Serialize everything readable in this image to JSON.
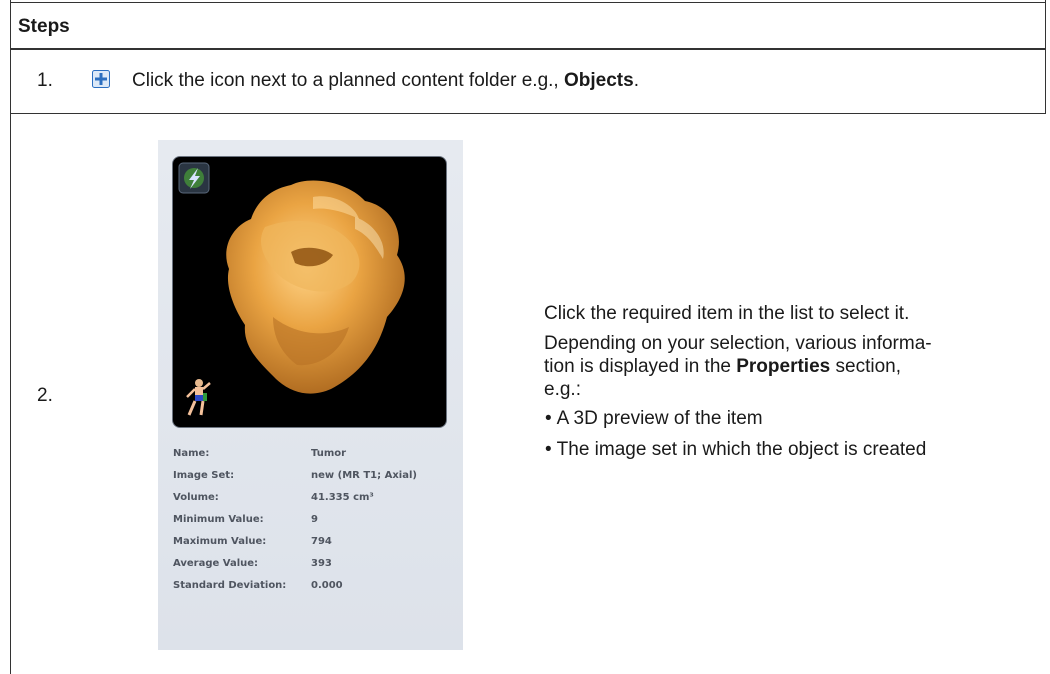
{
  "header": {
    "title": "Steps"
  },
  "step1": {
    "number": "1.",
    "icon": "expand-plus-icon",
    "text_before": "Click the icon next to a planned content folder e.g., ",
    "bold": "Objects",
    "text_after": "."
  },
  "step2": {
    "number": "2.",
    "viewer_icons": [
      "lightning-orientation-icon",
      "patient-orientation-figure-icon"
    ],
    "properties": [
      {
        "label": "Name:",
        "value": "Tumor"
      },
      {
        "label": "Image Set:",
        "value": "new (MR T1; Axial)"
      },
      {
        "label": "Volume:",
        "value": "41.335  cm³"
      },
      {
        "label": "Minimum Value:",
        "value": "9"
      },
      {
        "label": "Maximum Value:",
        "value": "794"
      },
      {
        "label": "Average Value:",
        "value": "393"
      },
      {
        "label": "Standard Deviation:",
        "value": "0.000"
      }
    ],
    "description": {
      "p1": "Click the required item in the list to select it.",
      "p2_line1": "Depending on your selection, various informa-",
      "p2_line2_before": "tion is displayed in the ",
      "p2_bold": "Properties",
      "p2_line2_after": " section,",
      "p2_line3": "e.g.:",
      "bullets": [
        "A 3D preview of the item",
        "The image set in which the object is created"
      ]
    }
  },
  "colors": {
    "rule": "#333333",
    "icon_blue": "#2c6fc0",
    "tumor": "#e8a646"
  }
}
